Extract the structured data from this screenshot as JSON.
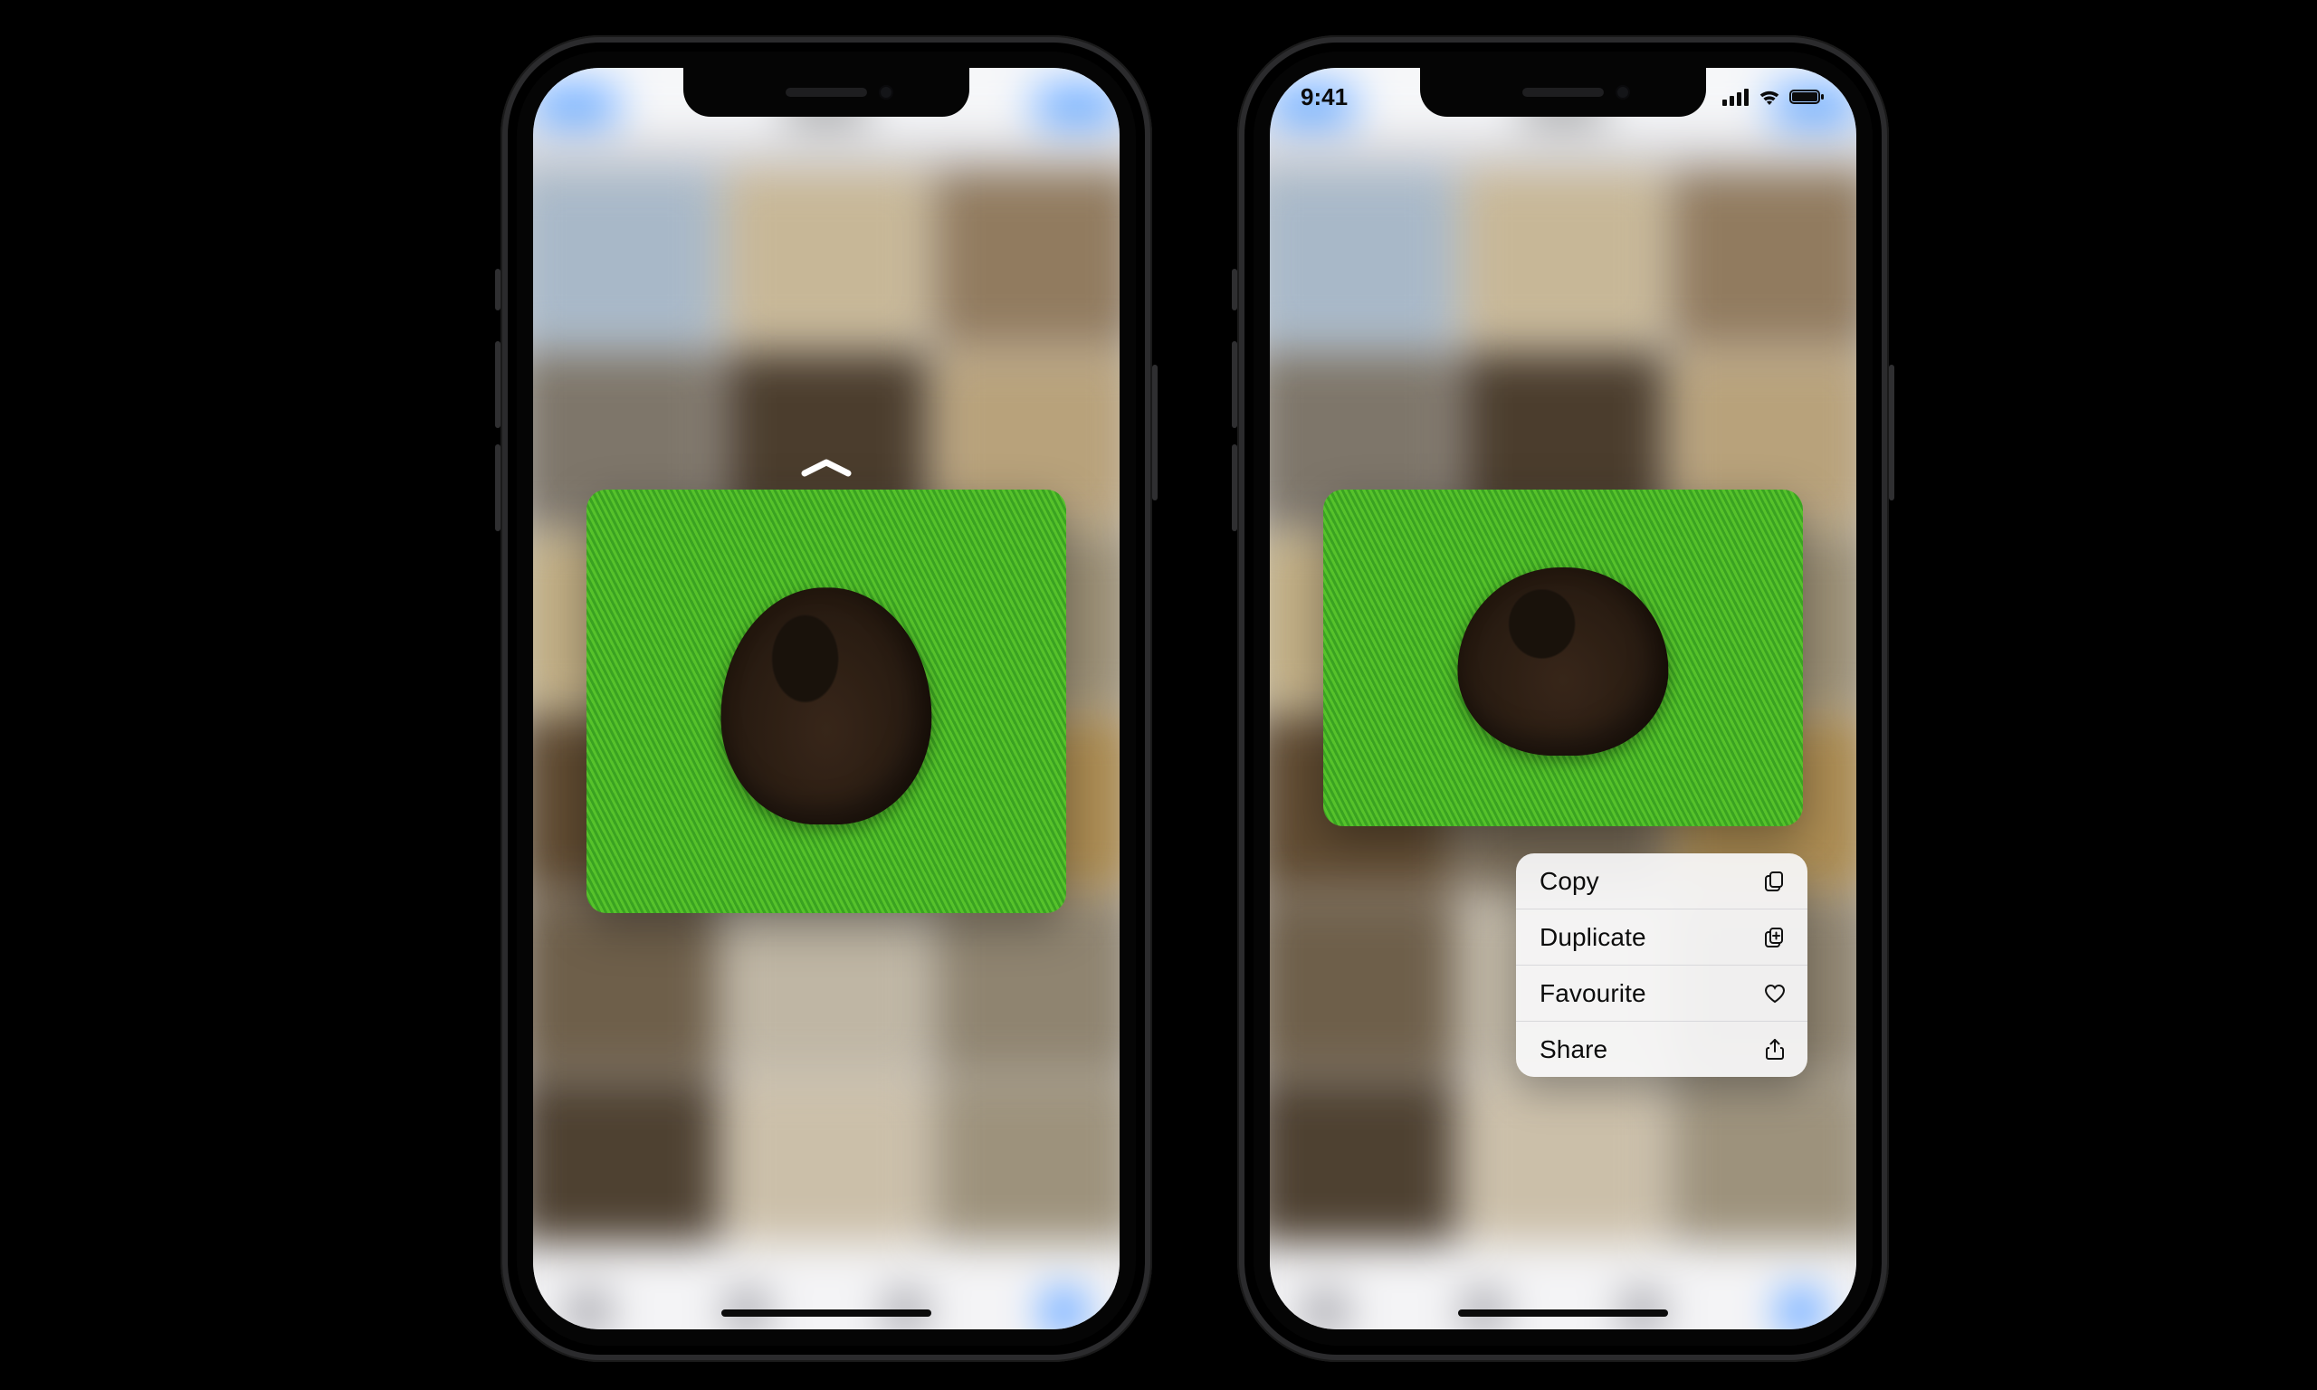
{
  "status": {
    "time": "9:41"
  },
  "hint": {
    "icon_name": "chevron-up-icon"
  },
  "menu": {
    "items": [
      {
        "label": "Copy",
        "icon_name": "copy-icon"
      },
      {
        "label": "Duplicate",
        "icon_name": "duplicate-icon"
      },
      {
        "label": "Favourite",
        "icon_name": "heart-icon"
      },
      {
        "label": "Share",
        "icon_name": "share-icon"
      }
    ]
  },
  "preview": {
    "subject_name": "photo-preview"
  }
}
